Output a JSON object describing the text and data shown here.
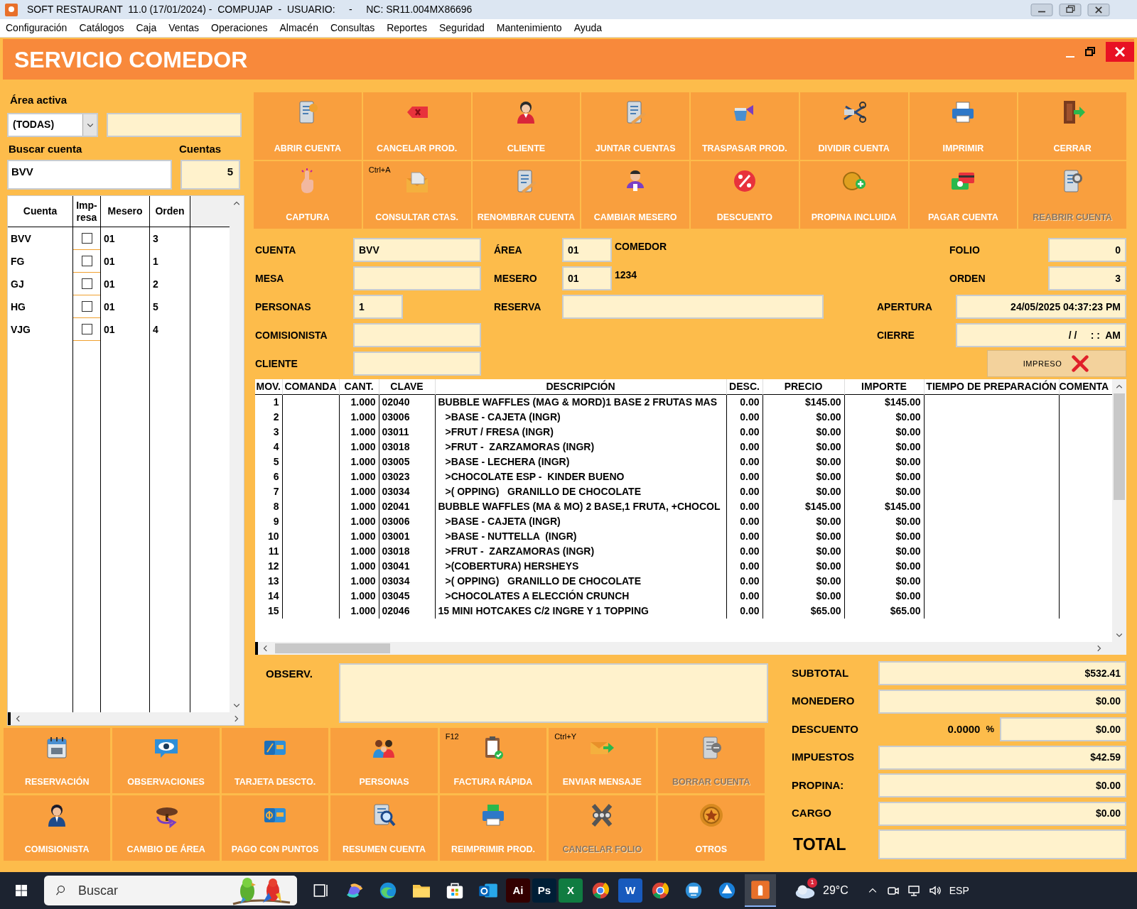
{
  "title_bar": {
    "title": "SOFT RESTAURANT  11.0 (17/01/2024) -  COMPUJAP  -  USUARIO:     -     NC: SR11.004MX86696"
  },
  "menu": [
    "Configuración",
    "Catálogos",
    "Caja",
    "Ventas",
    "Operaciones",
    "Almacén",
    "Consultas",
    "Reportes",
    "Seguridad",
    "Mantenimiento",
    "Ayuda"
  ],
  "header": {
    "title": "SERVICIO COMEDOR"
  },
  "accounts_panel": {
    "area_label": "Área activa",
    "area_select": "(TODAS)",
    "search_label": "Buscar cuenta",
    "search_value": "BVV",
    "count_label": "Cuentas",
    "count_value": "5",
    "columns": [
      "Cuenta",
      "Imp-resa",
      "Mesero",
      "Orden"
    ],
    "rows": [
      {
        "cuenta": "BVV",
        "impresa": false,
        "mesero": "01",
        "orden": "3"
      },
      {
        "cuenta": "FG",
        "impresa": false,
        "mesero": "01",
        "orden": "1"
      },
      {
        "cuenta": "GJ",
        "impresa": false,
        "mesero": "01",
        "orden": "2"
      },
      {
        "cuenta": "HG",
        "impresa": false,
        "mesero": "01",
        "orden": "5"
      },
      {
        "cuenta": "VJG",
        "impresa": false,
        "mesero": "01",
        "orden": "4"
      }
    ]
  },
  "toolbar": [
    {
      "label": "ABRIR CUENTA",
      "disabled": false
    },
    {
      "label": "CANCELAR PROD.",
      "disabled": false
    },
    {
      "label": "CLIENTE",
      "disabled": false
    },
    {
      "label": "JUNTAR CUENTAS",
      "disabled": false
    },
    {
      "label": "TRASPASAR PROD.",
      "disabled": false
    },
    {
      "label": "DIVIDIR CUENTA",
      "disabled": false
    },
    {
      "label": "IMPRIMIR",
      "disabled": false
    },
    {
      "label": "CERRAR",
      "disabled": false
    },
    {
      "label": "CAPTURA",
      "disabled": false
    },
    {
      "label": "CONSULTAR CTAS.",
      "shortcut": "Ctrl+A",
      "disabled": false
    },
    {
      "label": "RENOMBRAR CUENTA",
      "disabled": false
    },
    {
      "label": "CAMBIAR MESERO",
      "disabled": false
    },
    {
      "label": "DESCUENTO",
      "disabled": false
    },
    {
      "label": "PROPINA INCLUIDA",
      "disabled": false
    },
    {
      "label": "PAGAR CUENTA",
      "disabled": false
    },
    {
      "label": "REABRIR CUENTA",
      "disabled": true
    }
  ],
  "account_form": {
    "cuenta": {
      "label": "CUENTA",
      "value": "BVV"
    },
    "area": {
      "label": "ÁREA",
      "value": "01",
      "name": "COMEDOR"
    },
    "folio": {
      "label": "FOLIO",
      "value": "0"
    },
    "mesa": {
      "label": "MESA"
    },
    "mesero": {
      "label": "MESERO",
      "value": "01",
      "name": "1234"
    },
    "orden": {
      "label": "ORDEN",
      "value": "3"
    },
    "personas": {
      "label": "PERSONAS",
      "value": "1"
    },
    "reserva": {
      "label": "RESERVA"
    },
    "apertura": {
      "label": "APERTURA",
      "value": "24/05/2025 04:37:23 PM"
    },
    "comisionista": {
      "label": "COMISIONISTA"
    },
    "cierre": {
      "label": "CIERRE",
      "value": "/ /     : :  AM"
    },
    "cliente": {
      "label": "CLIENTE"
    },
    "impreso_button": {
      "label": "IMPRESO"
    }
  },
  "items_table": {
    "columns": [
      "MOV.",
      "COMANDA",
      "CANT.",
      "CLAVE",
      "DESCRIPCIÓN",
      "DESC.",
      "PRECIO",
      "IMPORTE",
      "TIEMPO DE PREPARACIÓN",
      "COMENTA"
    ],
    "rows": [
      {
        "mov": "1",
        "cant": "1.000",
        "clave": "02040",
        "descripcion": "BUBBLE WAFFLES (MAG & MORD)1 BASE 2 FRUTAS MAS",
        "kind": "product",
        "desc": "0.00",
        "precio": "$145.00",
        "importe": "$145.00"
      },
      {
        "mov": "2",
        "cant": "1.000",
        "clave": "03006",
        "descripcion": ">BASE - CAJETA (INGR)",
        "kind": "modifier",
        "desc": "0.00",
        "precio": "$0.00",
        "importe": "$0.00"
      },
      {
        "mov": "3",
        "cant": "1.000",
        "clave": "03011",
        "descripcion": ">FRUT / FRESA (INGR)",
        "kind": "modifier",
        "desc": "0.00",
        "precio": "$0.00",
        "importe": "$0.00"
      },
      {
        "mov": "4",
        "cant": "1.000",
        "clave": "03018",
        "descripcion": ">FRUT -  ZARZAMORAS (INGR)",
        "kind": "modifier",
        "desc": "0.00",
        "precio": "$0.00",
        "importe": "$0.00"
      },
      {
        "mov": "5",
        "cant": "1.000",
        "clave": "03005",
        "descripcion": ">BASE - LECHERA (INGR)",
        "kind": "modifier",
        "desc": "0.00",
        "precio": "$0.00",
        "importe": "$0.00"
      },
      {
        "mov": "6",
        "cant": "1.000",
        "clave": "03023",
        "descripcion": ">CHOCOLATE ESP -  KINDER BUENO",
        "kind": "modifier",
        "desc": "0.00",
        "precio": "$0.00",
        "importe": "$0.00"
      },
      {
        "mov": "7",
        "cant": "1.000",
        "clave": "03034",
        "descripcion": ">( OPPING)   GRANILLO DE CHOCOLATE",
        "kind": "modifier",
        "desc": "0.00",
        "precio": "$0.00",
        "importe": "$0.00"
      },
      {
        "mov": "8",
        "cant": "1.000",
        "clave": "02041",
        "descripcion": "BUBBLE WAFFLES (MA & MO) 2 BASE,1 FRUTA, +CHOCOL",
        "kind": "product",
        "desc": "0.00",
        "precio": "$145.00",
        "importe": "$145.00"
      },
      {
        "mov": "9",
        "cant": "1.000",
        "clave": "03006",
        "descripcion": ">BASE - CAJETA (INGR)",
        "kind": "modifier",
        "desc": "0.00",
        "precio": "$0.00",
        "importe": "$0.00"
      },
      {
        "mov": "10",
        "cant": "1.000",
        "clave": "03001",
        "descripcion": ">BASE - NUTTELLA  (INGR)",
        "kind": "modifier",
        "desc": "0.00",
        "precio": "$0.00",
        "importe": "$0.00"
      },
      {
        "mov": "11",
        "cant": "1.000",
        "clave": "03018",
        "descripcion": ">FRUT -  ZARZAMORAS (INGR)",
        "kind": "modifier",
        "desc": "0.00",
        "precio": "$0.00",
        "importe": "$0.00"
      },
      {
        "mov": "12",
        "cant": "1.000",
        "clave": "03041",
        "descripcion": ">(COBERTURA) HERSHEYS",
        "kind": "modifier",
        "desc": "0.00",
        "precio": "$0.00",
        "importe": "$0.00"
      },
      {
        "mov": "13",
        "cant": "1.000",
        "clave": "03034",
        "descripcion": ">( OPPING)   GRANILLO DE CHOCOLATE",
        "kind": "modifier",
        "desc": "0.00",
        "precio": "$0.00",
        "importe": "$0.00"
      },
      {
        "mov": "14",
        "cant": "1.000",
        "clave": "03045",
        "descripcion": ">CHOCOLATES A ELECCIÓN CRUNCH",
        "kind": "modifier",
        "desc": "0.00",
        "precio": "$0.00",
        "importe": "$0.00"
      },
      {
        "mov": "15",
        "cant": "1.000",
        "clave": "02046",
        "descripcion": "15 MINI HOTCAKES C/2 INGRE Y 1 TOPPING",
        "kind": "product",
        "desc": "0.00",
        "precio": "$65.00",
        "importe": "$65.00"
      }
    ]
  },
  "observations": {
    "label": "OBSERV."
  },
  "totals": [
    {
      "label": "SUBTOTAL",
      "kind": "line",
      "value": "$532.41"
    },
    {
      "label": "MONEDERO",
      "kind": "line",
      "value": "$0.00"
    },
    {
      "label": "DESCUENTO",
      "kind": "discount",
      "percent": "0.0000",
      "percent_sign": "%",
      "value": "$0.00"
    },
    {
      "label": "IMPUESTOS",
      "kind": "line",
      "value": "$42.59"
    },
    {
      "label": "PROPINA:",
      "kind": "line",
      "value": "$0.00"
    },
    {
      "label": "CARGO",
      "kind": "line",
      "value": "$0.00"
    },
    {
      "label": "TOTAL",
      "kind": "grand"
    }
  ],
  "action_buttons": [
    {
      "label": "RESERVACIÓN",
      "disabled": false
    },
    {
      "label": "OBSERVACIONES",
      "disabled": false
    },
    {
      "label": "TARJETA DESCTO.",
      "disabled": false
    },
    {
      "label": "PERSONAS",
      "disabled": false
    },
    {
      "label": "FACTURA RÁPIDA",
      "shortcut": "F12",
      "disabled": false
    },
    {
      "label": "ENVIAR MENSAJE",
      "shortcut": "Ctrl+Y",
      "disabled": false
    },
    {
      "label": "BORRAR CUENTA",
      "disabled": true
    },
    {
      "label": "COMISIONISTA",
      "disabled": false
    },
    {
      "label": "CAMBIO DE ÁREA",
      "disabled": false
    },
    {
      "label": "PAGO CON PUNTOS",
      "disabled": false
    },
    {
      "label": "RESUMEN CUENTA",
      "disabled": false
    },
    {
      "label": "REIMPRIMIR PROD.",
      "disabled": false
    },
    {
      "label": "CANCELAR FOLIO",
      "disabled": true
    },
    {
      "label": "OTROS",
      "disabled": false
    }
  ],
  "taskbar": {
    "search_placeholder": "Buscar",
    "apps": [
      {
        "kind": "taskview"
      },
      {
        "kind": "copilot"
      },
      {
        "kind": "edge"
      },
      {
        "kind": "folder"
      },
      {
        "kind": "store"
      },
      {
        "kind": "outlook"
      },
      {
        "kind": "letter",
        "label": "Ai",
        "color": "#330000"
      },
      {
        "kind": "letter",
        "label": "Ps",
        "color": "#001e36"
      },
      {
        "kind": "letter",
        "label": "X",
        "color": "#107c41"
      },
      {
        "kind": "chrome"
      },
      {
        "kind": "letter",
        "label": "W",
        "color": "#185abd"
      },
      {
        "kind": "chrome"
      },
      {
        "kind": "remote"
      },
      {
        "kind": "drive"
      },
      {
        "kind": "restaurant",
        "active": true
      }
    ],
    "weather": {
      "temperature": "29°C",
      "badge": "1"
    },
    "language": "ESP"
  }
}
